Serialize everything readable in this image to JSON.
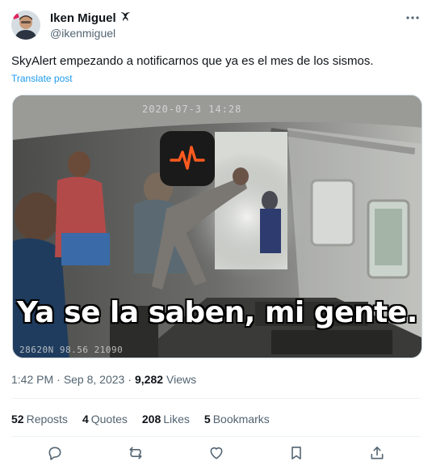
{
  "author": {
    "name": "Iken Miguel",
    "handle": "@ikenmiguel",
    "verified": true
  },
  "tweet": {
    "text": "SkyAlert empezando a notificarnos que ya es el mes de los sismos.",
    "translate_label": "Translate post"
  },
  "media": {
    "caption": "Ya se la saben, mi gente.",
    "timestamp_top": "2020-07-3  14:28",
    "timestamp_bottom": "28620N 98.56 21090"
  },
  "meta": {
    "time": "1:42 PM",
    "separator": "·",
    "date": "Sep 8, 2023",
    "views_count": "9,282",
    "views_label": "Views"
  },
  "stats": {
    "reposts_count": "52",
    "reposts_label": "Reposts",
    "quotes_count": "4",
    "quotes_label": "Quotes",
    "likes_count": "208",
    "likes_label": "Likes",
    "bookmarks_count": "5",
    "bookmarks_label": "Bookmarks"
  },
  "colors": {
    "text": "#0f1419",
    "secondary": "#536471",
    "link": "#1d9bf0",
    "divider": "#eff3f4",
    "skyalert_orange": "#ff5a1f"
  },
  "icons": [
    "more-icon",
    "verified-icon",
    "reply-icon",
    "repost-icon",
    "like-icon",
    "bookmark-icon",
    "share-icon",
    "skyalert-logo-icon"
  ]
}
